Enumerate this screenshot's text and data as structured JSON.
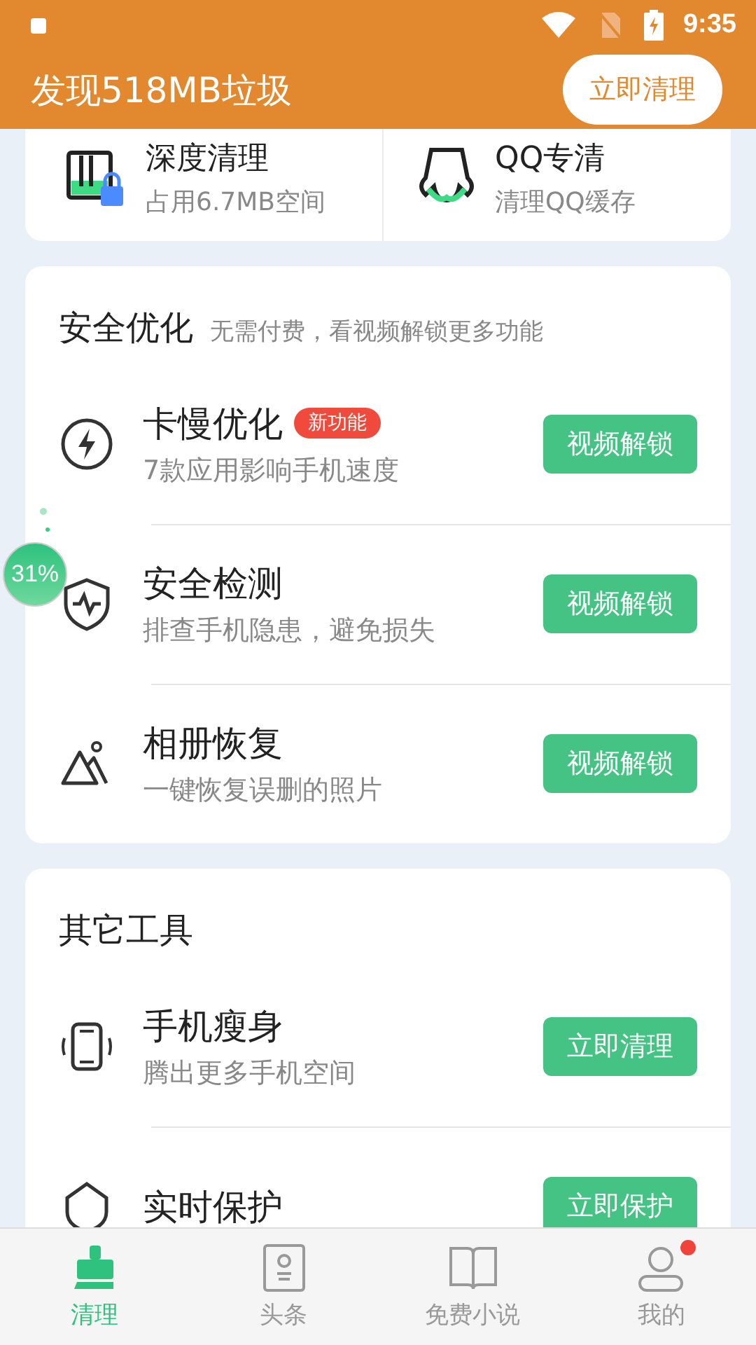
{
  "status_bar": {
    "time": "9:35"
  },
  "header": {
    "title": "发现518MB垃圾",
    "button": "立即清理"
  },
  "top_tools": [
    {
      "title": "深度清理",
      "subtitle": "占用6.7MB空间",
      "kind": "storage"
    },
    {
      "title": "QQ专清",
      "subtitle": "清理QQ缓存",
      "kind": "penguin"
    }
  ],
  "sections": [
    {
      "title": "安全优化",
      "note": "无需付费，看视频解锁更多功能",
      "items": [
        {
          "kind": "bolt",
          "title": "卡慢优化",
          "badge": "新功能",
          "subtitle": "7款应用影响手机速度",
          "button": "视频解锁"
        },
        {
          "kind": "shield",
          "title": "安全检测",
          "subtitle": "排查手机隐患，避免损失",
          "button": "视频解锁"
        },
        {
          "kind": "photo",
          "title": "相册恢复",
          "subtitle": "一键恢复误删的照片",
          "button": "视频解锁"
        }
      ]
    },
    {
      "title": "其它工具",
      "items": [
        {
          "kind": "phone",
          "title": "手机瘦身",
          "subtitle": "腾出更多手机空间",
          "button": "立即清理"
        },
        {
          "kind": "guard",
          "title": "实时保护",
          "button": "立即保护"
        }
      ]
    }
  ],
  "floating_ball": {
    "label": "31%"
  },
  "tabs": [
    {
      "label": "清理",
      "kind": "broom",
      "selected": true,
      "dot": false
    },
    {
      "label": "头条",
      "kind": "news",
      "selected": false,
      "dot": false
    },
    {
      "label": "免费小说",
      "kind": "book",
      "selected": false,
      "dot": false
    },
    {
      "label": "我的",
      "kind": "user",
      "selected": false,
      "dot": true
    }
  ]
}
